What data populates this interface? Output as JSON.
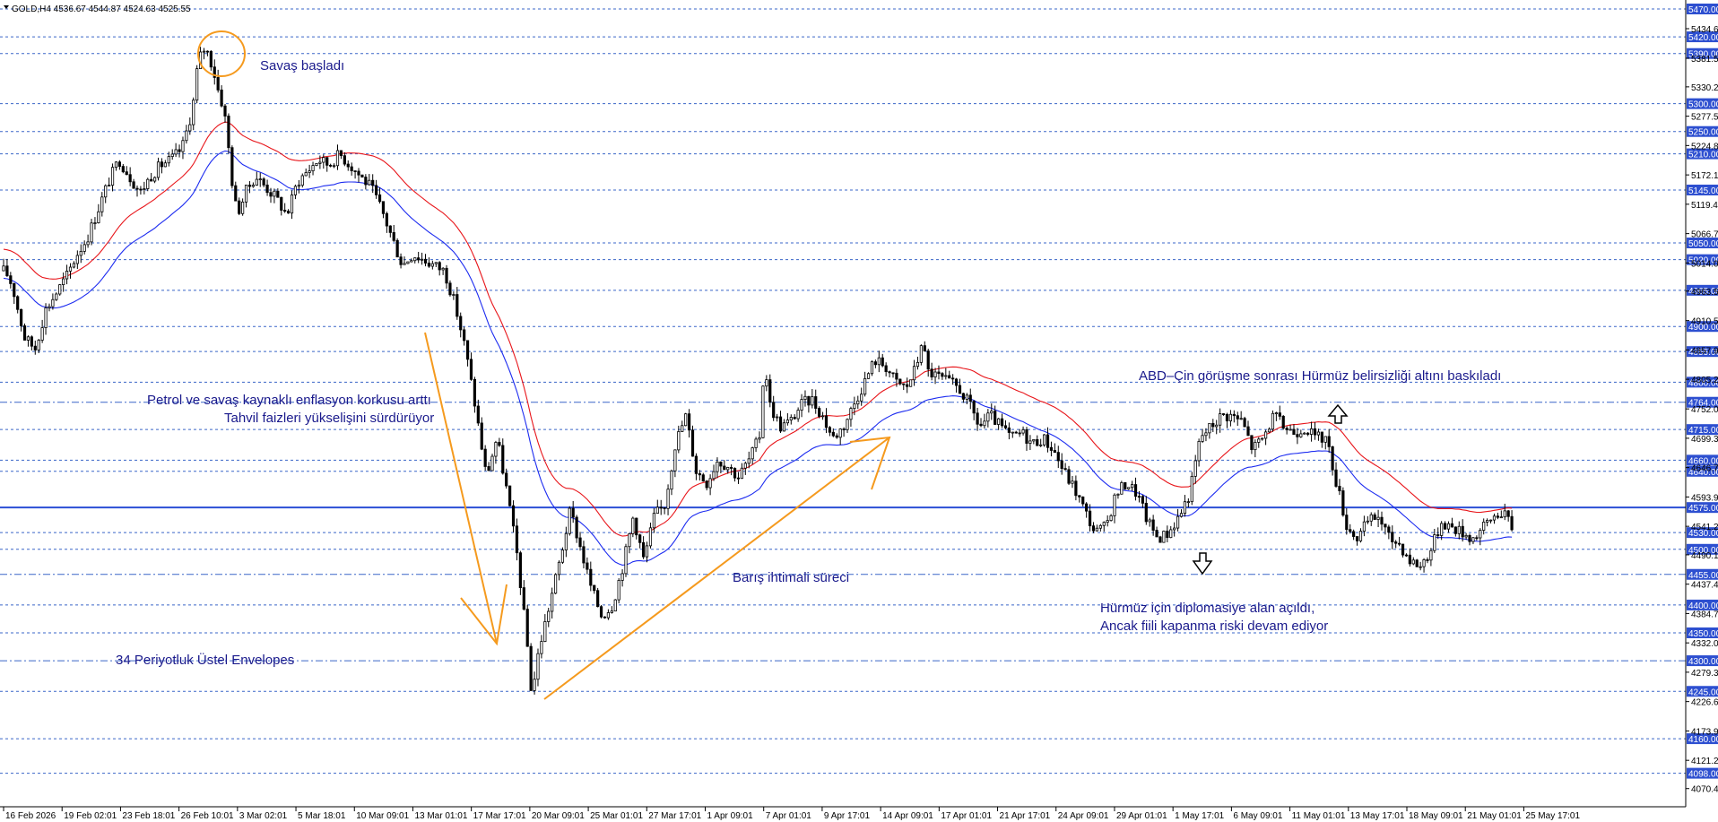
{
  "header": {
    "symbol_line": "GOLD,H4  4536.67 4544.87 4524.63 4525.55"
  },
  "chart_data": {
    "type": "candlestick",
    "symbol": "GOLD",
    "timeframe": "H4",
    "ohlc_header": {
      "open": 4536.67,
      "high": 4544.87,
      "low": 4524.63,
      "close": 4525.55
    },
    "ylim": [
      4070,
      5470
    ],
    "price_ticks": [
      5434.6,
      5381.55,
      5330.2,
      5277.5,
      5224.85,
      5172.1,
      5119.45,
      5066.7,
      5014.05,
      4963.5,
      4910.55,
      4857.9,
      4805.2,
      4752.05,
      4699.35,
      4646.7,
      4593.95,
      4541.25,
      4490.1,
      4437.4,
      4384.75,
      4332.0,
      4279.35,
      4226.65,
      4173.9,
      4121.2,
      4070.45
    ],
    "level_lines": [
      {
        "value": "5470.00",
        "style": "dashed"
      },
      {
        "value": "5420.00",
        "style": "dashed"
      },
      {
        "value": "5390.00",
        "style": "dashed"
      },
      {
        "value": "5300.00",
        "style": "dashed"
      },
      {
        "value": "5250.00",
        "style": "dashed"
      },
      {
        "value": "5210.00",
        "style": "dashed"
      },
      {
        "value": "5145.00",
        "style": "dashed"
      },
      {
        "value": "5050.00",
        "style": "dashed"
      },
      {
        "value": "5020.00",
        "style": "dashed"
      },
      {
        "value": "4965.00",
        "style": "dashed"
      },
      {
        "value": "4900.00",
        "style": "dashed"
      },
      {
        "value": "4855.00",
        "style": "dashed"
      },
      {
        "value": "4800.00",
        "style": "dashed"
      },
      {
        "value": "4764.00",
        "style": "dashdot"
      },
      {
        "value": "4715.00",
        "style": "dashed"
      },
      {
        "value": "4660.00",
        "style": "dashed"
      },
      {
        "value": "4640.00",
        "style": "dashed"
      },
      {
        "value": "4575.00",
        "style": "solid"
      },
      {
        "value": "4530.00",
        "style": "dashed"
      },
      {
        "value": "4500.00",
        "style": "dashed"
      },
      {
        "value": "4455.00",
        "style": "dashdot"
      },
      {
        "value": "4400.00",
        "style": "dashed"
      },
      {
        "value": "4350.00",
        "style": "dashed"
      },
      {
        "value": "4300.00",
        "style": "dashdot"
      },
      {
        "value": "4245.00",
        "style": "dashed"
      },
      {
        "value": "4160.00",
        "style": "dashed"
      },
      {
        "value": "4098.00",
        "style": "dashed"
      }
    ],
    "time_labels": [
      "16 Feb 2026",
      "19 Feb 02:01",
      "23 Feb 18:01",
      "26 Feb 10:01",
      "3 Mar 02:01",
      "5 Mar 18:01",
      "10 Mar 09:01",
      "13 Mar 01:01",
      "17 Mar 17:01",
      "20 Mar 09:01",
      "25 Mar 01:01",
      "27 Mar 17:01",
      "1 Apr 09:01",
      "7 Apr 01:01",
      "9 Apr 17:01",
      "14 Apr 09:01",
      "17 Apr 01:01",
      "21 Apr 17:01",
      "24 Apr 09:01",
      "29 Apr 01:01",
      "1 May 17:01",
      "6 May 09:01",
      "11 May 01:01",
      "13 May 17:01",
      "18 May 09:01",
      "21 May 01:01",
      "25 May 17:01"
    ],
    "price_path": [
      [
        0,
        5000
      ],
      [
        0.5,
        4990
      ],
      [
        1,
        4960
      ],
      [
        2,
        4880
      ],
      [
        3,
        4860
      ],
      [
        4,
        4930
      ],
      [
        5,
        4960
      ],
      [
        6,
        4990
      ],
      [
        7,
        5030
      ],
      [
        8,
        5060
      ],
      [
        9,
        5110
      ],
      [
        10,
        5160
      ],
      [
        11,
        5200
      ],
      [
        12,
        5170
      ],
      [
        13,
        5140
      ],
      [
        14,
        5170
      ],
      [
        15,
        5190
      ],
      [
        16,
        5200
      ],
      [
        17,
        5220
      ],
      [
        18,
        5290
      ],
      [
        18.5,
        5370
      ],
      [
        19,
        5400
      ],
      [
        19.5,
        5390
      ],
      [
        20,
        5360
      ],
      [
        20.5,
        5320
      ],
      [
        21,
        5290
      ],
      [
        21.5,
        5210
      ],
      [
        22,
        5120
      ],
      [
        22.5,
        5110
      ],
      [
        23,
        5140
      ],
      [
        24,
        5170
      ],
      [
        25,
        5150
      ],
      [
        26,
        5130
      ],
      [
        27,
        5100
      ],
      [
        28,
        5160
      ],
      [
        29,
        5180
      ],
      [
        30,
        5200
      ],
      [
        31,
        5190
      ],
      [
        32,
        5210
      ],
      [
        33,
        5190
      ],
      [
        34,
        5170
      ],
      [
        35,
        5150
      ],
      [
        36,
        5110
      ],
      [
        37,
        5060
      ],
      [
        38,
        5010
      ],
      [
        39,
        5030
      ],
      [
        40,
        5020
      ],
      [
        41,
        5010
      ],
      [
        42,
        5000
      ],
      [
        43,
        4940
      ],
      [
        44,
        4860
      ],
      [
        45,
        4750
      ],
      [
        46,
        4630
      ],
      [
        47,
        4700
      ],
      [
        48,
        4600
      ],
      [
        49,
        4480
      ],
      [
        50,
        4310
      ],
      [
        50.3,
        4240
      ],
      [
        50.6,
        4270
      ],
      [
        51,
        4320
      ],
      [
        52,
        4400
      ],
      [
        53,
        4480
      ],
      [
        54,
        4570
      ],
      [
        55,
        4500
      ],
      [
        56,
        4430
      ],
      [
        57,
        4380
      ],
      [
        58,
        4400
      ],
      [
        59,
        4470
      ],
      [
        60,
        4560
      ],
      [
        61,
        4480
      ],
      [
        62,
        4560
      ],
      [
        63,
        4580
      ],
      [
        64,
        4690
      ],
      [
        65,
        4740
      ],
      [
        66,
        4640
      ],
      [
        67,
        4620
      ],
      [
        68,
        4660
      ],
      [
        69,
        4650
      ],
      [
        70,
        4630
      ],
      [
        71,
        4660
      ],
      [
        72,
        4700
      ],
      [
        72.5,
        4840
      ],
      [
        73,
        4760
      ],
      [
        74,
        4720
      ],
      [
        75,
        4730
      ],
      [
        76,
        4760
      ],
      [
        77,
        4770
      ],
      [
        78,
        4740
      ],
      [
        79,
        4700
      ],
      [
        80,
        4720
      ],
      [
        81,
        4760
      ],
      [
        82,
        4800
      ],
      [
        83,
        4840
      ],
      [
        84,
        4830
      ],
      [
        85,
        4800
      ],
      [
        86,
        4790
      ],
      [
        87,
        4830
      ],
      [
        87.5,
        4880
      ],
      [
        88,
        4820
      ],
      [
        89,
        4810
      ],
      [
        90,
        4800
      ],
      [
        91,
        4790
      ],
      [
        92,
        4760
      ],
      [
        93,
        4720
      ],
      [
        94,
        4740
      ],
      [
        95,
        4720
      ],
      [
        96,
        4700
      ],
      [
        97,
        4710
      ],
      [
        98,
        4690
      ],
      [
        99,
        4700
      ],
      [
        100,
        4680
      ],
      [
        101,
        4640
      ],
      [
        102,
        4610
      ],
      [
        103,
        4570
      ],
      [
        104,
        4530
      ],
      [
        105,
        4540
      ],
      [
        106,
        4600
      ],
      [
        107,
        4620
      ],
      [
        108,
        4600
      ],
      [
        109,
        4550
      ],
      [
        110,
        4520
      ],
      [
        111,
        4530
      ],
      [
        112,
        4560
      ],
      [
        113,
        4600
      ],
      [
        114,
        4700
      ],
      [
        115,
        4720
      ],
      [
        116,
        4740
      ],
      [
        117,
        4740
      ],
      [
        118,
        4730
      ],
      [
        119,
        4680
      ],
      [
        120,
        4700
      ],
      [
        121,
        4740
      ],
      [
        122,
        4720
      ],
      [
        123,
        4710
      ],
      [
        124,
        4720
      ],
      [
        125,
        4700
      ],
      [
        126,
        4700
      ],
      [
        127,
        4620
      ],
      [
        128,
        4540
      ],
      [
        129,
        4520
      ],
      [
        130,
        4550
      ],
      [
        131,
        4560
      ],
      [
        132,
        4520
      ],
      [
        133,
        4510
      ],
      [
        134,
        4480
      ],
      [
        135,
        4470
      ],
      [
        136,
        4500
      ],
      [
        137,
        4550
      ],
      [
        138,
        4540
      ],
      [
        139,
        4530
      ],
      [
        140,
        4520
      ],
      [
        141,
        4540
      ],
      [
        142,
        4560
      ],
      [
        143,
        4570
      ],
      [
        143.7,
        4530
      ]
    ],
    "annotations": {
      "war_started": "Savaş başladı",
      "inflation_fear": "Petrol ve savaş kaynaklı enflasyon korkusu arttı",
      "yields_rising": "Tahvil faizleri yükselişini sürdürüyor",
      "peace_process": "Barış ihtimali süreci",
      "envelopes": "34 Periyotluk Üstel Envelopes",
      "us_china": "ABD–Çin görüşme sonrası Hürmüz belirsizliği altını baskıladı",
      "hormuz_diplomacy": "Hürmüz için diplomasiye alan açıldı,",
      "closure_risk": "Ancak fiili kapanma riski devam ediyor"
    },
    "colors": {
      "candle": "#000000",
      "envelope_upper": "#e8161b",
      "envelope_lower": "#1d2cf0",
      "grid": "#3a66c8",
      "level_label_bg": "#2d4fd0",
      "arrow": "#f59a1e",
      "highlight_line": "#2c4fd6"
    }
  }
}
